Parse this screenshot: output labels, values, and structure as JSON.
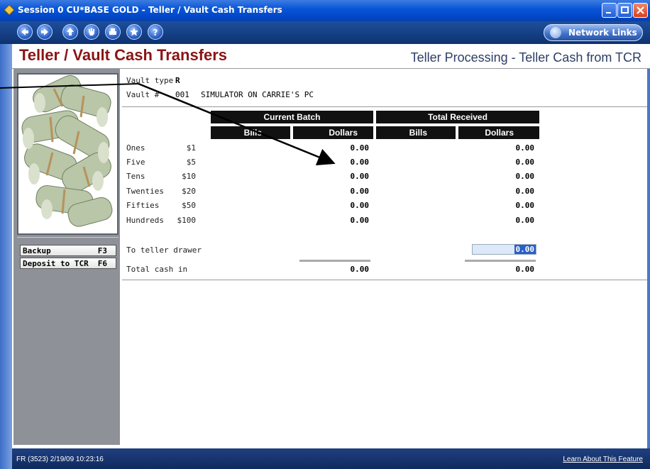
{
  "window": {
    "title": "Session 0 CU*BASE GOLD - Teller / Vault Cash Transfers"
  },
  "toolbar": {
    "nav_icons": [
      "back-icon",
      "forward-icon",
      "up-icon",
      "hand-icon",
      "print-icon",
      "star-icon",
      "help-icon"
    ],
    "network_links_label": "Network Links"
  },
  "header": {
    "title": "Teller / Vault Cash Transfers",
    "subtitle": "Teller Processing - Teller Cash from TCR"
  },
  "sidebar": {
    "buttons": [
      {
        "label": "Backup",
        "key": "F3"
      },
      {
        "label": "Deposit to TCR",
        "key": "F6"
      }
    ]
  },
  "vault": {
    "type_label": "Vault type",
    "type_value": "R",
    "num_label": "Vault #",
    "num_value": "001",
    "desc": "SIMULATOR ON CARRIE'S PC"
  },
  "table": {
    "group_headers": [
      "Current Batch",
      "Total Received"
    ],
    "sub_headers": [
      "Bills",
      "Dollars",
      "Bills",
      "Dollars"
    ],
    "rows": [
      {
        "label": "Ones",
        "denom": "$1",
        "batch_dollars": "0.00",
        "total_dollars": "0.00"
      },
      {
        "label": "Five",
        "denom": "$5",
        "batch_dollars": "0.00",
        "total_dollars": "0.00"
      },
      {
        "label": "Tens",
        "denom": "$10",
        "batch_dollars": "0.00",
        "total_dollars": "0.00"
      },
      {
        "label": "Twenties",
        "denom": "$20",
        "batch_dollars": "0.00",
        "total_dollars": "0.00"
      },
      {
        "label": "Fifties",
        "denom": "$50",
        "batch_dollars": "0.00",
        "total_dollars": "0.00"
      },
      {
        "label": "Hundreds",
        "denom": "$100",
        "batch_dollars": "0.00",
        "total_dollars": "0.00"
      }
    ],
    "to_teller_label": "To teller drawer",
    "to_teller_value": "0.00",
    "total_label": "Total cash in",
    "total_batch": "0.00",
    "total_received": "0.00"
  },
  "status": {
    "left": "FR (3523) 2/19/09 10:23:16",
    "right": "Learn About This Feature"
  },
  "colors": {
    "title_red": "#8a1414",
    "accent_blue": "#0a56d8",
    "input_bg": "#dde8f8"
  }
}
